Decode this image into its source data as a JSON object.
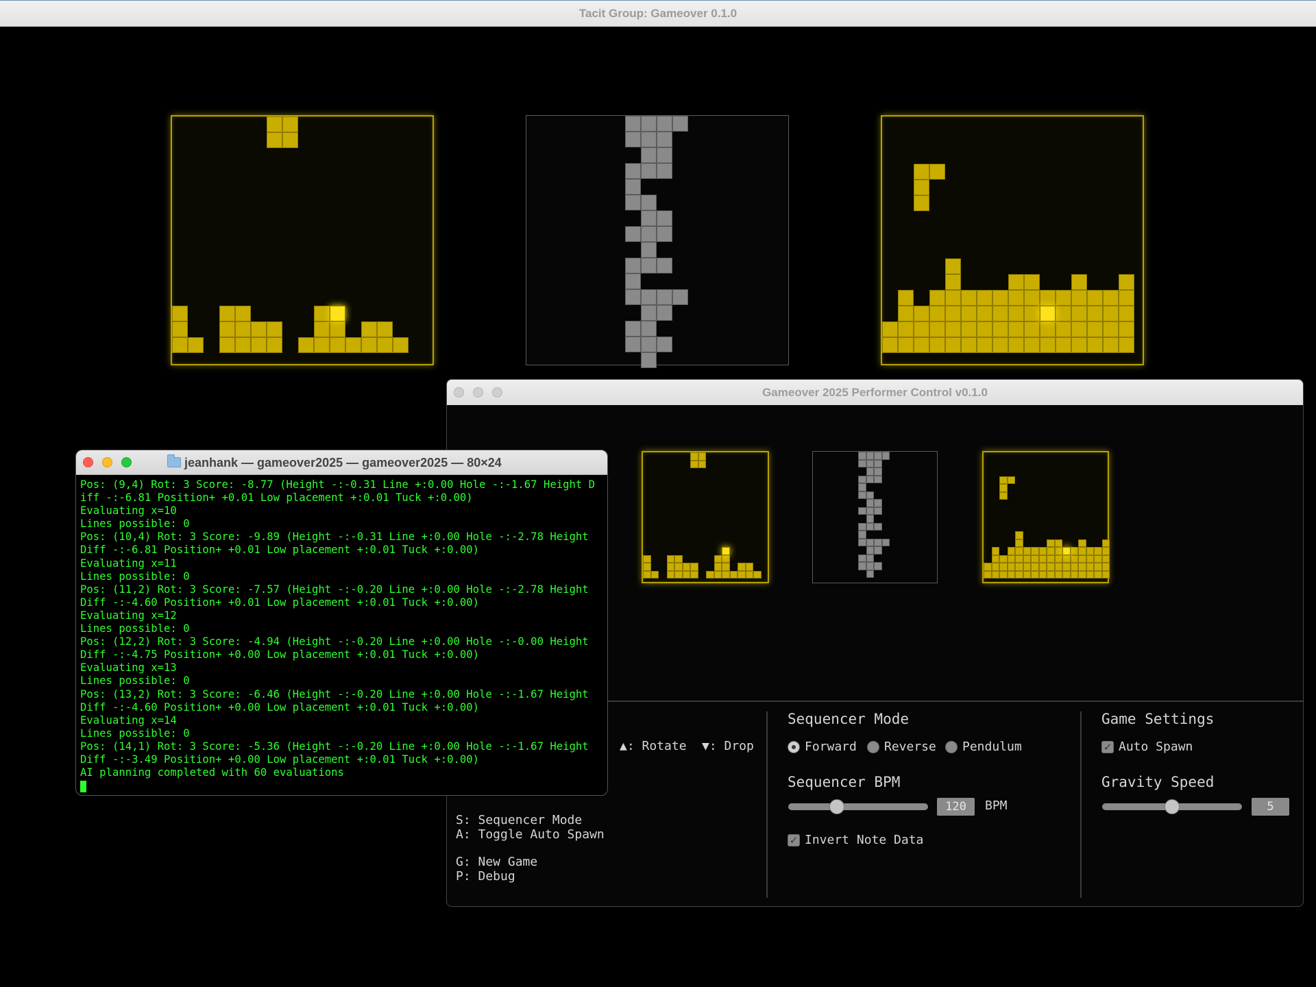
{
  "main_window": {
    "title": "Tacit Group: Gameover 0.1.0"
  },
  "colors": {
    "accent_yellow": "#c9ae00",
    "board_gray": "#8a8a8a",
    "terminal_green": "#2fff2f",
    "background": "#000000"
  },
  "performer": {
    "title": "Gameover 2025 Performer Control v0.1.0",
    "controls": {
      "rotate": "▲: Rotate",
      "drop": "▼: Drop",
      "seq_mode_key": "S: Sequencer Mode",
      "auto_spawn_key": "A: Toggle Auto Spawn",
      "new_game_key": "G: New Game",
      "debug_key": "P: Debug"
    },
    "sequencer": {
      "title": "Sequencer Mode",
      "modes": [
        "Forward",
        "Reverse",
        "Pendulum"
      ],
      "selected_mode": "Forward",
      "bpm_title": "Sequencer BPM",
      "bpm_value": "120",
      "bpm_unit": "BPM",
      "bpm_slider_fraction": 0.35,
      "invert_label": "Invert Note Data",
      "invert_checked": true
    },
    "game_settings": {
      "title": "Game Settings",
      "auto_spawn_label": "Auto Spawn",
      "auto_spawn_checked": true,
      "gravity_title": "Gravity Speed",
      "gravity_value": "5",
      "gravity_slider_fraction": 0.5
    }
  },
  "boards": {
    "left": {
      "falling": [
        [
          6,
          0
        ],
        [
          7,
          0
        ],
        [
          6,
          1
        ],
        [
          7,
          1
        ]
      ],
      "glow": [
        [
          10,
          12
        ]
      ],
      "heights": [
        3,
        1,
        0,
        3,
        3,
        2,
        2,
        0,
        1,
        3,
        3,
        1,
        2,
        2,
        1,
        0
      ]
    },
    "center": {
      "rows": [
        [
          0,
          1,
          2,
          3
        ],
        [
          0,
          1,
          2
        ],
        [
          1,
          2
        ],
        [
          0,
          1,
          2
        ],
        [
          0
        ],
        [
          0,
          1
        ],
        [
          1,
          2
        ],
        [
          0,
          1,
          2
        ],
        [
          1
        ],
        [
          0,
          1,
          2
        ],
        [
          0
        ],
        [
          0,
          1,
          2,
          3
        ],
        [
          1,
          2
        ],
        [
          0,
          1
        ],
        [
          0,
          1,
          2
        ],
        [
          1
        ]
      ]
    },
    "right": {
      "falling": [
        [
          2,
          3
        ],
        [
          3,
          3
        ],
        [
          2,
          4
        ],
        [
          2,
          5
        ]
      ],
      "glow": [
        [
          10,
          12
        ]
      ],
      "heights": [
        2,
        4,
        3,
        4,
        6,
        4,
        4,
        4,
        5,
        5,
        4,
        4,
        5,
        4,
        4,
        5
      ]
    }
  },
  "terminal": {
    "title": "jeanhank — gameover2025 — gameover2025 — 80×24",
    "lines": [
      "Pos: (9,4) Rot: 3 Score: -8.77 (Height -:-0.31 Line +:0.00 Hole -:-1.67 Height D",
      "iff -:-6.81 Position+ +0.01 Low placement +:0.01 Tuck +:0.00)",
      "Evaluating x=10",
      "Lines possible: 0",
      "Pos: (10,4) Rot: 3 Score: -9.89 (Height -:-0.31 Line +:0.00 Hole -:-2.78 Height",
      "Diff -:-6.81 Position+ +0.01 Low placement +:0.01 Tuck +:0.00)",
      "Evaluating x=11",
      "Lines possible: 0",
      "Pos: (11,2) Rot: 3 Score: -7.57 (Height -:-0.20 Line +:0.00 Hole -:-2.78 Height",
      "Diff -:-4.60 Position+ +0.01 Low placement +:0.01 Tuck +:0.00)",
      "Evaluating x=12",
      "Lines possible: 0",
      "Pos: (12,2) Rot: 3 Score: -4.94 (Height -:-0.20 Line +:0.00 Hole -:-0.00 Height",
      "Diff -:-4.75 Position+ +0.00 Low placement +:0.01 Tuck +:0.00)",
      "Evaluating x=13",
      "Lines possible: 0",
      "Pos: (13,2) Rot: 3 Score: -6.46 (Height -:-0.20 Line +:0.00 Hole -:-1.67 Height",
      "Diff -:-4.60 Position+ +0.00 Low placement +:0.01 Tuck +:0.00)",
      "Evaluating x=14",
      "Lines possible: 0",
      "Pos: (14,1) Rot: 3 Score: -5.36 (Height -:-0.20 Line +:0.00 Hole -:-1.67 Height",
      "Diff -:-3.49 Position+ +0.00 Low placement +:0.01 Tuck +:0.00)",
      "AI planning completed with 60 evaluations"
    ]
  }
}
